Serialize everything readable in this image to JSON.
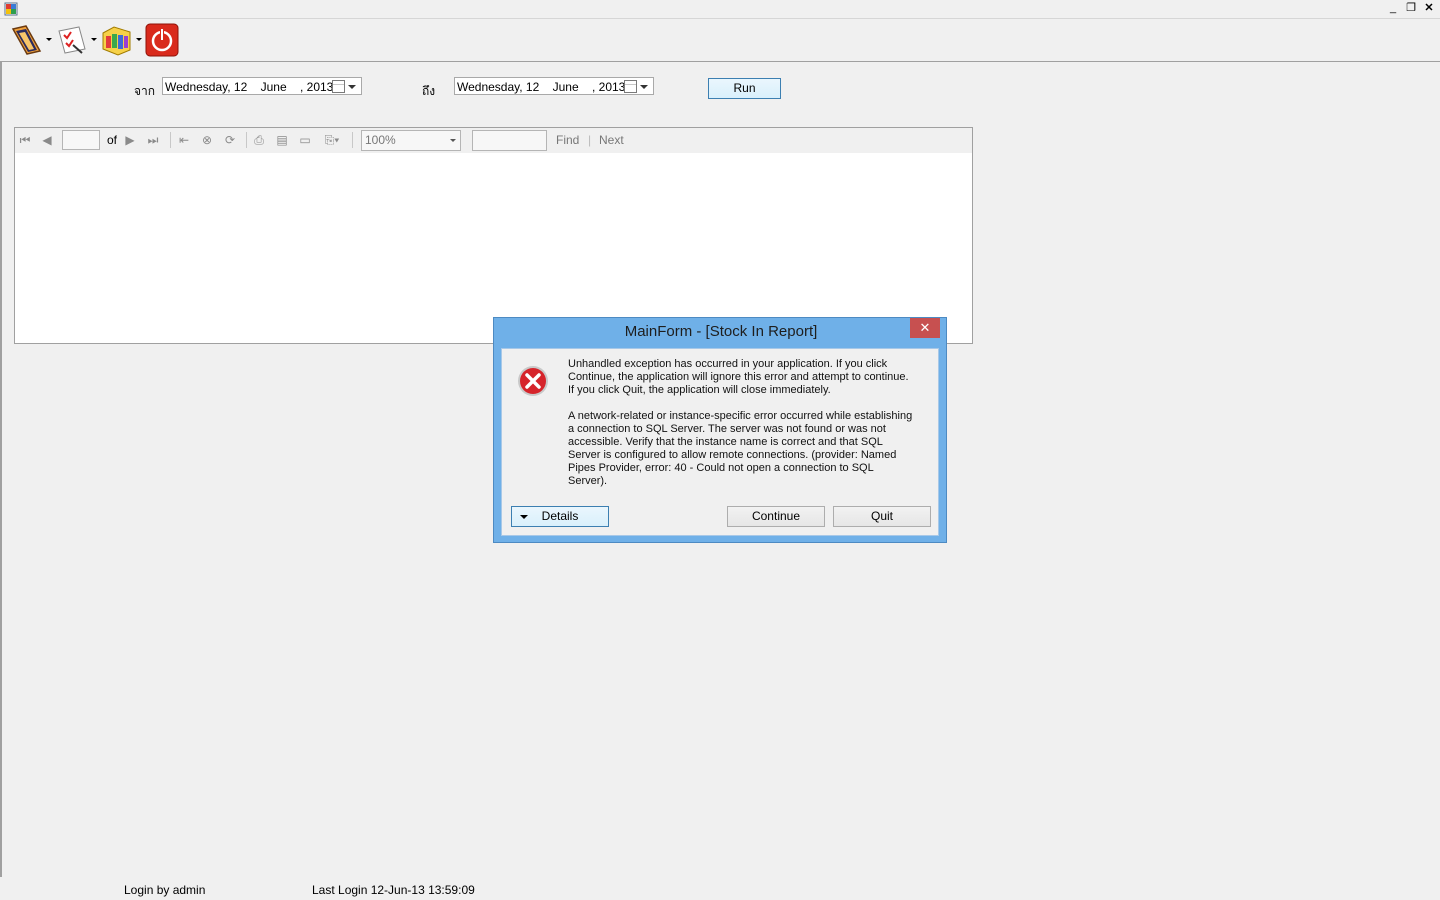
{
  "window": {
    "minimize": "_",
    "restore": "❐",
    "close": "✕"
  },
  "toolbar": {
    "items": [
      {
        "icon": "report-book-icon"
      },
      {
        "icon": "checklist-icon"
      },
      {
        "icon": "stock-boxes-icon"
      },
      {
        "icon": "power-icon"
      }
    ]
  },
  "filters": {
    "from_label": "จาก",
    "from_date": "Wednesday, 12    June    , 2013",
    "to_label": "ถึง",
    "to_date": "Wednesday, 12    June    , 2013",
    "run_label": "Run"
  },
  "report_viewer": {
    "page_of": "of",
    "zoom": "100%",
    "find_label": "Find",
    "separator": "|",
    "next_label": "Next"
  },
  "dialog": {
    "title": "MainForm - [Stock In Report]",
    "close": "✕",
    "message1": "Unhandled exception has occurred in your application. If you click Continue, the application will ignore this error and attempt to continue. If you click Quit, the application will close immediately.",
    "message2": "A network-related or instance-specific error occurred while establishing a connection to SQL Server. The server was not found or was not accessible. Verify that the instance name is correct and that SQL Server is configured to allow remote connections. (provider: Named Pipes Provider, error: 40 - Could not open a connection to SQL Server).",
    "details_label": "Details",
    "continue_label": "Continue",
    "quit_label": "Quit"
  },
  "status": {
    "login": "Login by admin",
    "last_login": "Last Login 12-Jun-13 13:59:09"
  }
}
